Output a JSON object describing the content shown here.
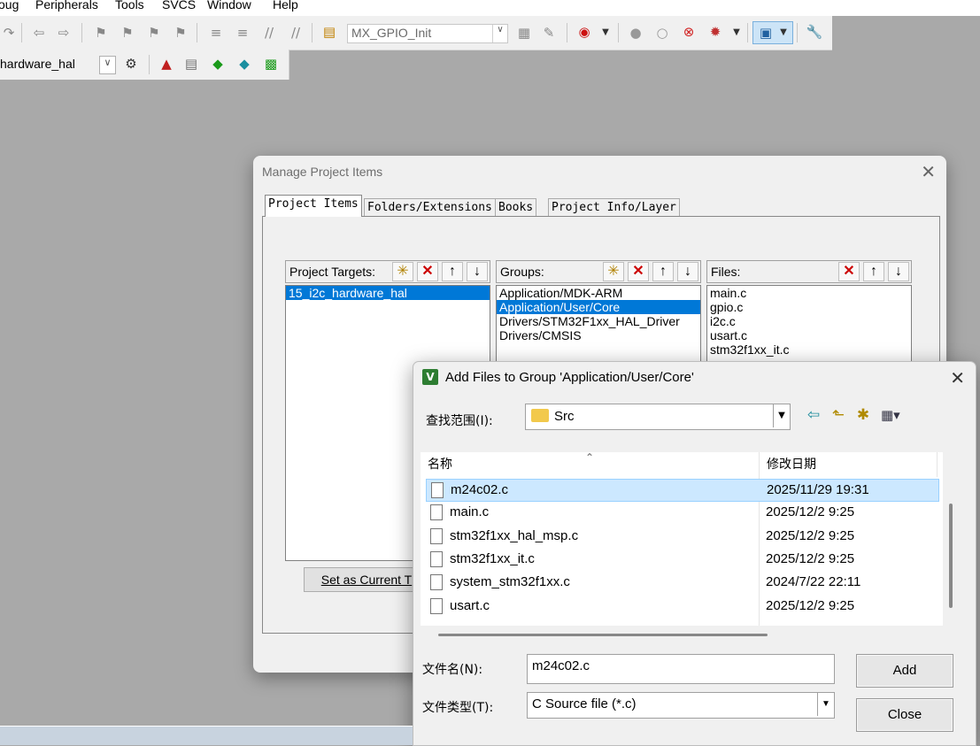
{
  "menu": [
    "oug",
    "Peripherals",
    "Tools",
    "SVCS",
    "Window",
    "Help"
  ],
  "toolbar": {
    "function_combo": "MX_GPIO_Init",
    "target_combo": "hardware_hal"
  },
  "manage_dialog": {
    "title": "Manage Project Items",
    "tabs": [
      "Project Items",
      "Folders/Extensions",
      "Books",
      "Project Info/Layer"
    ],
    "targets": {
      "header": "Project Targets:",
      "items": [
        "15_i2c_hardware_hal"
      ],
      "selected": 0
    },
    "groups": {
      "header": "Groups:",
      "items": [
        "Application/MDK-ARM",
        "Application/User/Core",
        "Drivers/STM32F1xx_HAL_Driver",
        "Drivers/CMSIS"
      ],
      "selected": 1
    },
    "files": {
      "header": "Files:",
      "items": [
        "main.c",
        "gpio.c",
        "i2c.c",
        "usart.c",
        "stm32f1xx_it.c"
      ]
    },
    "set_current_button": "Set as Current T"
  },
  "add_dialog": {
    "title": "Add Files to Group 'Application/User/Core'",
    "lookin_label": "查找范围(I):",
    "lookin_value": "Src",
    "columns": [
      "名称",
      "修改日期"
    ],
    "files": [
      {
        "name": "m24c02.c",
        "date": "2025/11/29 19:31"
      },
      {
        "name": "main.c",
        "date": "2025/12/2 9:25"
      },
      {
        "name": "stm32f1xx_hal_msp.c",
        "date": "2025/12/2 9:25"
      },
      {
        "name": "stm32f1xx_it.c",
        "date": "2025/12/2 9:25"
      },
      {
        "name": "system_stm32f1xx.c",
        "date": "2024/7/22 22:11"
      },
      {
        "name": "usart.c",
        "date": "2025/12/2 9:25"
      }
    ],
    "selected_file": 0,
    "filename_label": "文件名(N):",
    "filename_value": "m24c02.c",
    "filetype_label": "文件类型(T):",
    "filetype_value": "C Source file (*.c)",
    "add_button": "Add",
    "close_button": "Close"
  }
}
